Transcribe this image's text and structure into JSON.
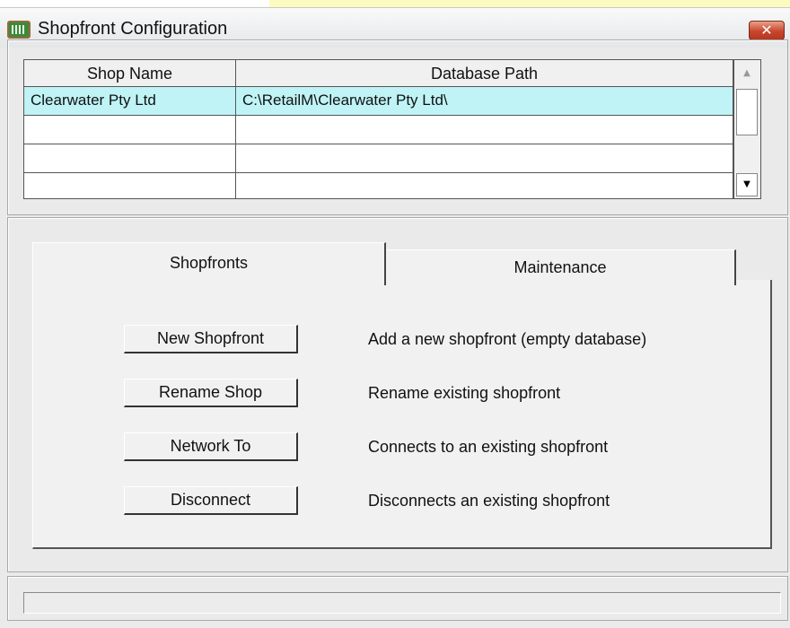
{
  "window": {
    "title": "Shopfront Configuration",
    "close_glyph": "✕"
  },
  "grid": {
    "columns": [
      "Shop Name",
      "Database Path"
    ],
    "rows": [
      {
        "shop_name": "Clearwater Pty Ltd",
        "database_path": "C:\\RetailM\\Clearwater Pty Ltd\\",
        "selected": true
      },
      {
        "shop_name": "",
        "database_path": "",
        "selected": false
      },
      {
        "shop_name": "",
        "database_path": "",
        "selected": false
      },
      {
        "shop_name": "",
        "database_path": "",
        "selected": false
      }
    ],
    "scroll_up_glyph": "▲",
    "scroll_down_glyph": "▼"
  },
  "tabs": [
    {
      "label": "Shopfronts",
      "active": true
    },
    {
      "label": "Maintenance",
      "active": false
    }
  ],
  "actions": [
    {
      "button": "New Shopfront",
      "description": "Add a new shopfront (empty database)"
    },
    {
      "button": "Rename Shop",
      "description": "Rename existing shopfront"
    },
    {
      "button": "Network To",
      "description": "Connects to an existing shopfront"
    },
    {
      "button": "Disconnect",
      "description": "Disconnects an existing shopfront"
    }
  ],
  "status": {
    "text": ""
  },
  "colors": {
    "selected_row": "#bff3f6",
    "close_button": "#c9452c",
    "window_bg": "#eaeaea"
  }
}
